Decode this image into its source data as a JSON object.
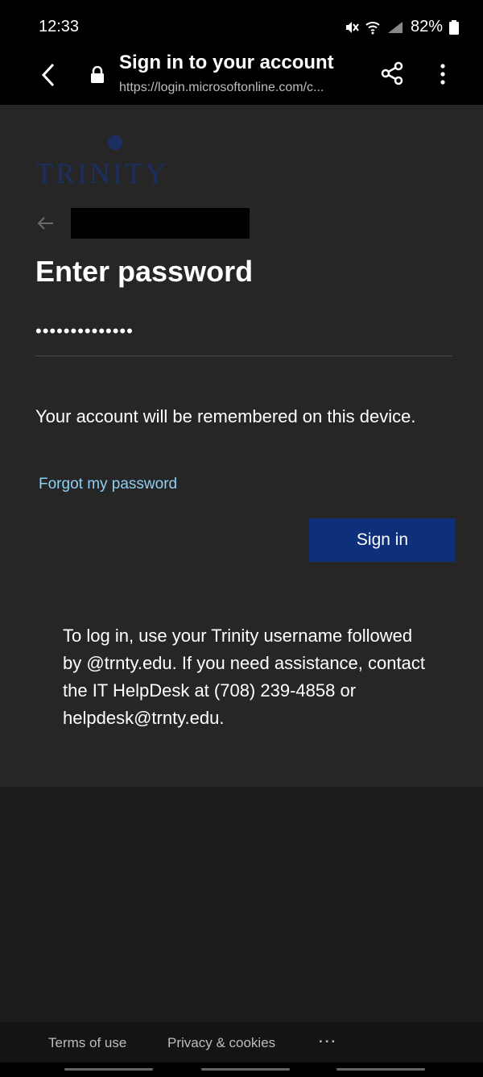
{
  "status": {
    "time": "12:33",
    "battery": "82%"
  },
  "browser": {
    "title": "Sign in to your account",
    "url": "https://login.microsoftonline.com/c..."
  },
  "card": {
    "logo_text": "TRINITY",
    "logo_color": "#1c2f62",
    "heading": "Enter password",
    "password_value": "••••••••••••••",
    "remember_text": "Your account will be remembered on this device.",
    "forgot_link": "Forgot my password",
    "signin_label": "Sign in",
    "signin_color": "#0e2f7a",
    "help_text": "To log in, use your Trinity username followed by @trnty.edu. If you need assistance, contact the IT HelpDesk at (708) 239-4858 or helpdesk@trnty.edu."
  },
  "footer": {
    "terms": "Terms of use",
    "privacy": "Privacy & cookies",
    "more": "..."
  },
  "icons": {
    "back": "back-arrow-icon",
    "lock": "lock-icon",
    "share": "share-icon",
    "more": "more-vert-icon",
    "mute": "mute-icon",
    "wifi": "wifi-icon",
    "signal": "signal-icon",
    "battery": "battery-icon"
  }
}
